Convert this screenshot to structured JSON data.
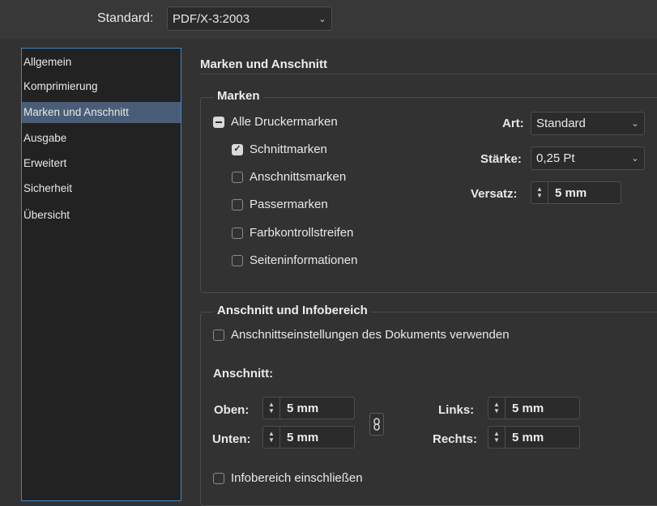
{
  "header": {
    "standard_label": "Standard:",
    "standard_value": "PDF/X-3:2003"
  },
  "sidebar": {
    "items": [
      {
        "label": "Allgemein"
      },
      {
        "label": "Komprimierung"
      },
      {
        "label": "Marken und Anschnitt",
        "active": true
      },
      {
        "label": "Ausgabe"
      },
      {
        "label": "Erweitert"
      },
      {
        "label": "Sicherheit"
      },
      {
        "label": "Übersicht"
      }
    ]
  },
  "section": {
    "title": "Marken und Anschnitt"
  },
  "marken": {
    "legend": "Marken",
    "all_marks": {
      "label": "Alle Druckermarken",
      "state": "mixed"
    },
    "checkboxes": [
      {
        "label": "Schnittmarken",
        "checked": true
      },
      {
        "label": "Anschnittsmarken",
        "checked": false
      },
      {
        "label": "Passermarken",
        "checked": false
      },
      {
        "label": "Farbkontrollstreifen",
        "checked": false
      },
      {
        "label": "Seiteninformationen",
        "checked": false
      }
    ],
    "art": {
      "label": "Art:",
      "value": "Standard"
    },
    "staerke": {
      "label": "Stärke:",
      "value": "0,25 Pt"
    },
    "versatz": {
      "label": "Versatz:",
      "value": "5 mm"
    }
  },
  "anschnitt_info": {
    "legend": "Anschnitt und Infobereich",
    "use_doc_settings": {
      "label": "Anschnittseinstellungen des Dokuments verwenden",
      "checked": false
    },
    "anschnitt_label": "Anschnitt:",
    "oben": {
      "label": "Oben:",
      "value": "5 mm"
    },
    "unten": {
      "label": "Unten:",
      "value": "5 mm"
    },
    "links": {
      "label": "Links:",
      "value": "5 mm"
    },
    "rechts": {
      "label": "Rechts:",
      "value": "5 mm"
    },
    "include_slug": {
      "label": "Infobereich einschließen",
      "checked": false
    }
  },
  "icons": {
    "chevron": "chevron-down-icon",
    "link": "chain-link-icon",
    "stepper": "stepper-arrows-icon"
  }
}
